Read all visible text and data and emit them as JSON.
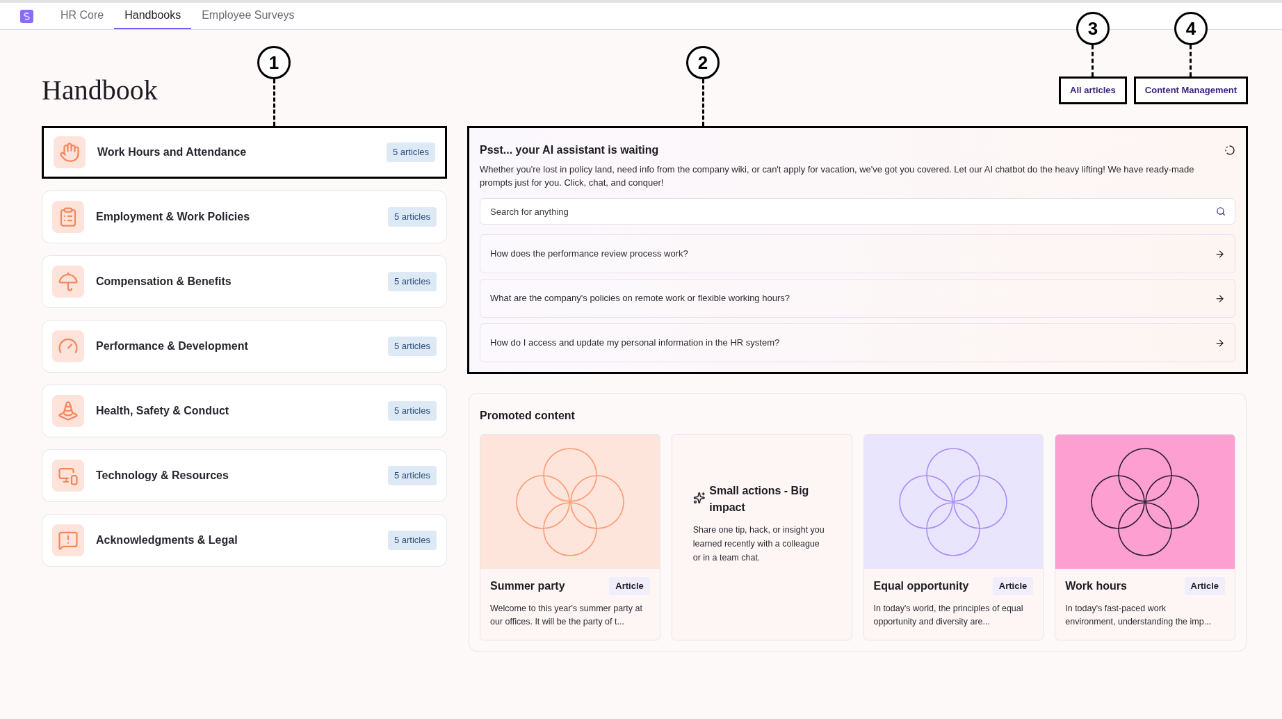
{
  "nav": {
    "tabs": [
      {
        "label": "HR Core",
        "selected": false
      },
      {
        "label": "Handbooks",
        "selected": true
      },
      {
        "label": "Employee Surveys",
        "selected": false
      }
    ]
  },
  "page_title": "Handbook",
  "header_buttons": [
    {
      "label": "All articles",
      "highlighted": true,
      "callout": "3"
    },
    {
      "label": "Content Management",
      "highlighted": true,
      "callout": "4"
    }
  ],
  "categories": [
    {
      "title": "Work Hours and Attendance",
      "count": "5 articles",
      "highlighted": true,
      "callout": "1"
    },
    {
      "title": "Employment & Work Policies",
      "count": "5 articles",
      "highlighted": false
    },
    {
      "title": "Compensation & Benefits",
      "count": "5 articles",
      "highlighted": false
    },
    {
      "title": "Performance & Development",
      "count": "5 articles",
      "highlighted": false
    },
    {
      "title": "Health, Safety & Conduct",
      "count": "5 articles",
      "highlighted": false
    },
    {
      "title": "Technology & Resources",
      "count": "5 articles",
      "highlighted": false
    },
    {
      "title": "Acknowledgments & Legal",
      "count": "5 articles",
      "highlighted": false
    }
  ],
  "assistant": {
    "title": "Psst... your AI assistant is waiting",
    "description": "Whether you're lost in policy land, need info from the company wiki, or can't apply for vacation, we've got you covered. Let our AI chatbot do the heavy lifting! We have ready-made prompts just for you. Click, chat, and conquer!",
    "highlighted": true,
    "callout": "2",
    "search": {
      "placeholder": "Search for anything"
    },
    "prompts": [
      "How does the performance review process work?",
      "What are the company's policies on remote work or flexible working hours?",
      "How do I access and update my personal information in the HR system?"
    ]
  },
  "promoted": {
    "title": "Promoted content",
    "cards": [
      {
        "kind": "article",
        "color": "#fde5dc",
        "title": "Summer party",
        "tag": "Article",
        "excerpt": "Welcome to this year's summer party at our offices. It will be the party of t..."
      },
      {
        "kind": "tip",
        "title": "Small actions - Big impact",
        "body": "Share one tip, hack, or insight you learned recently with a colleague or in a team chat."
      },
      {
        "kind": "article",
        "color": "#e9e5fc",
        "title": "Equal opportunity",
        "tag": "Article",
        "excerpt": "In today's world, the principles of equal opportunity and diversity are..."
      },
      {
        "kind": "article",
        "color": "#fe9fd2",
        "title": "Work hours",
        "tag": "Article",
        "excerpt": "In today's fast-paced work environment, understanding the imp..."
      }
    ]
  }
}
